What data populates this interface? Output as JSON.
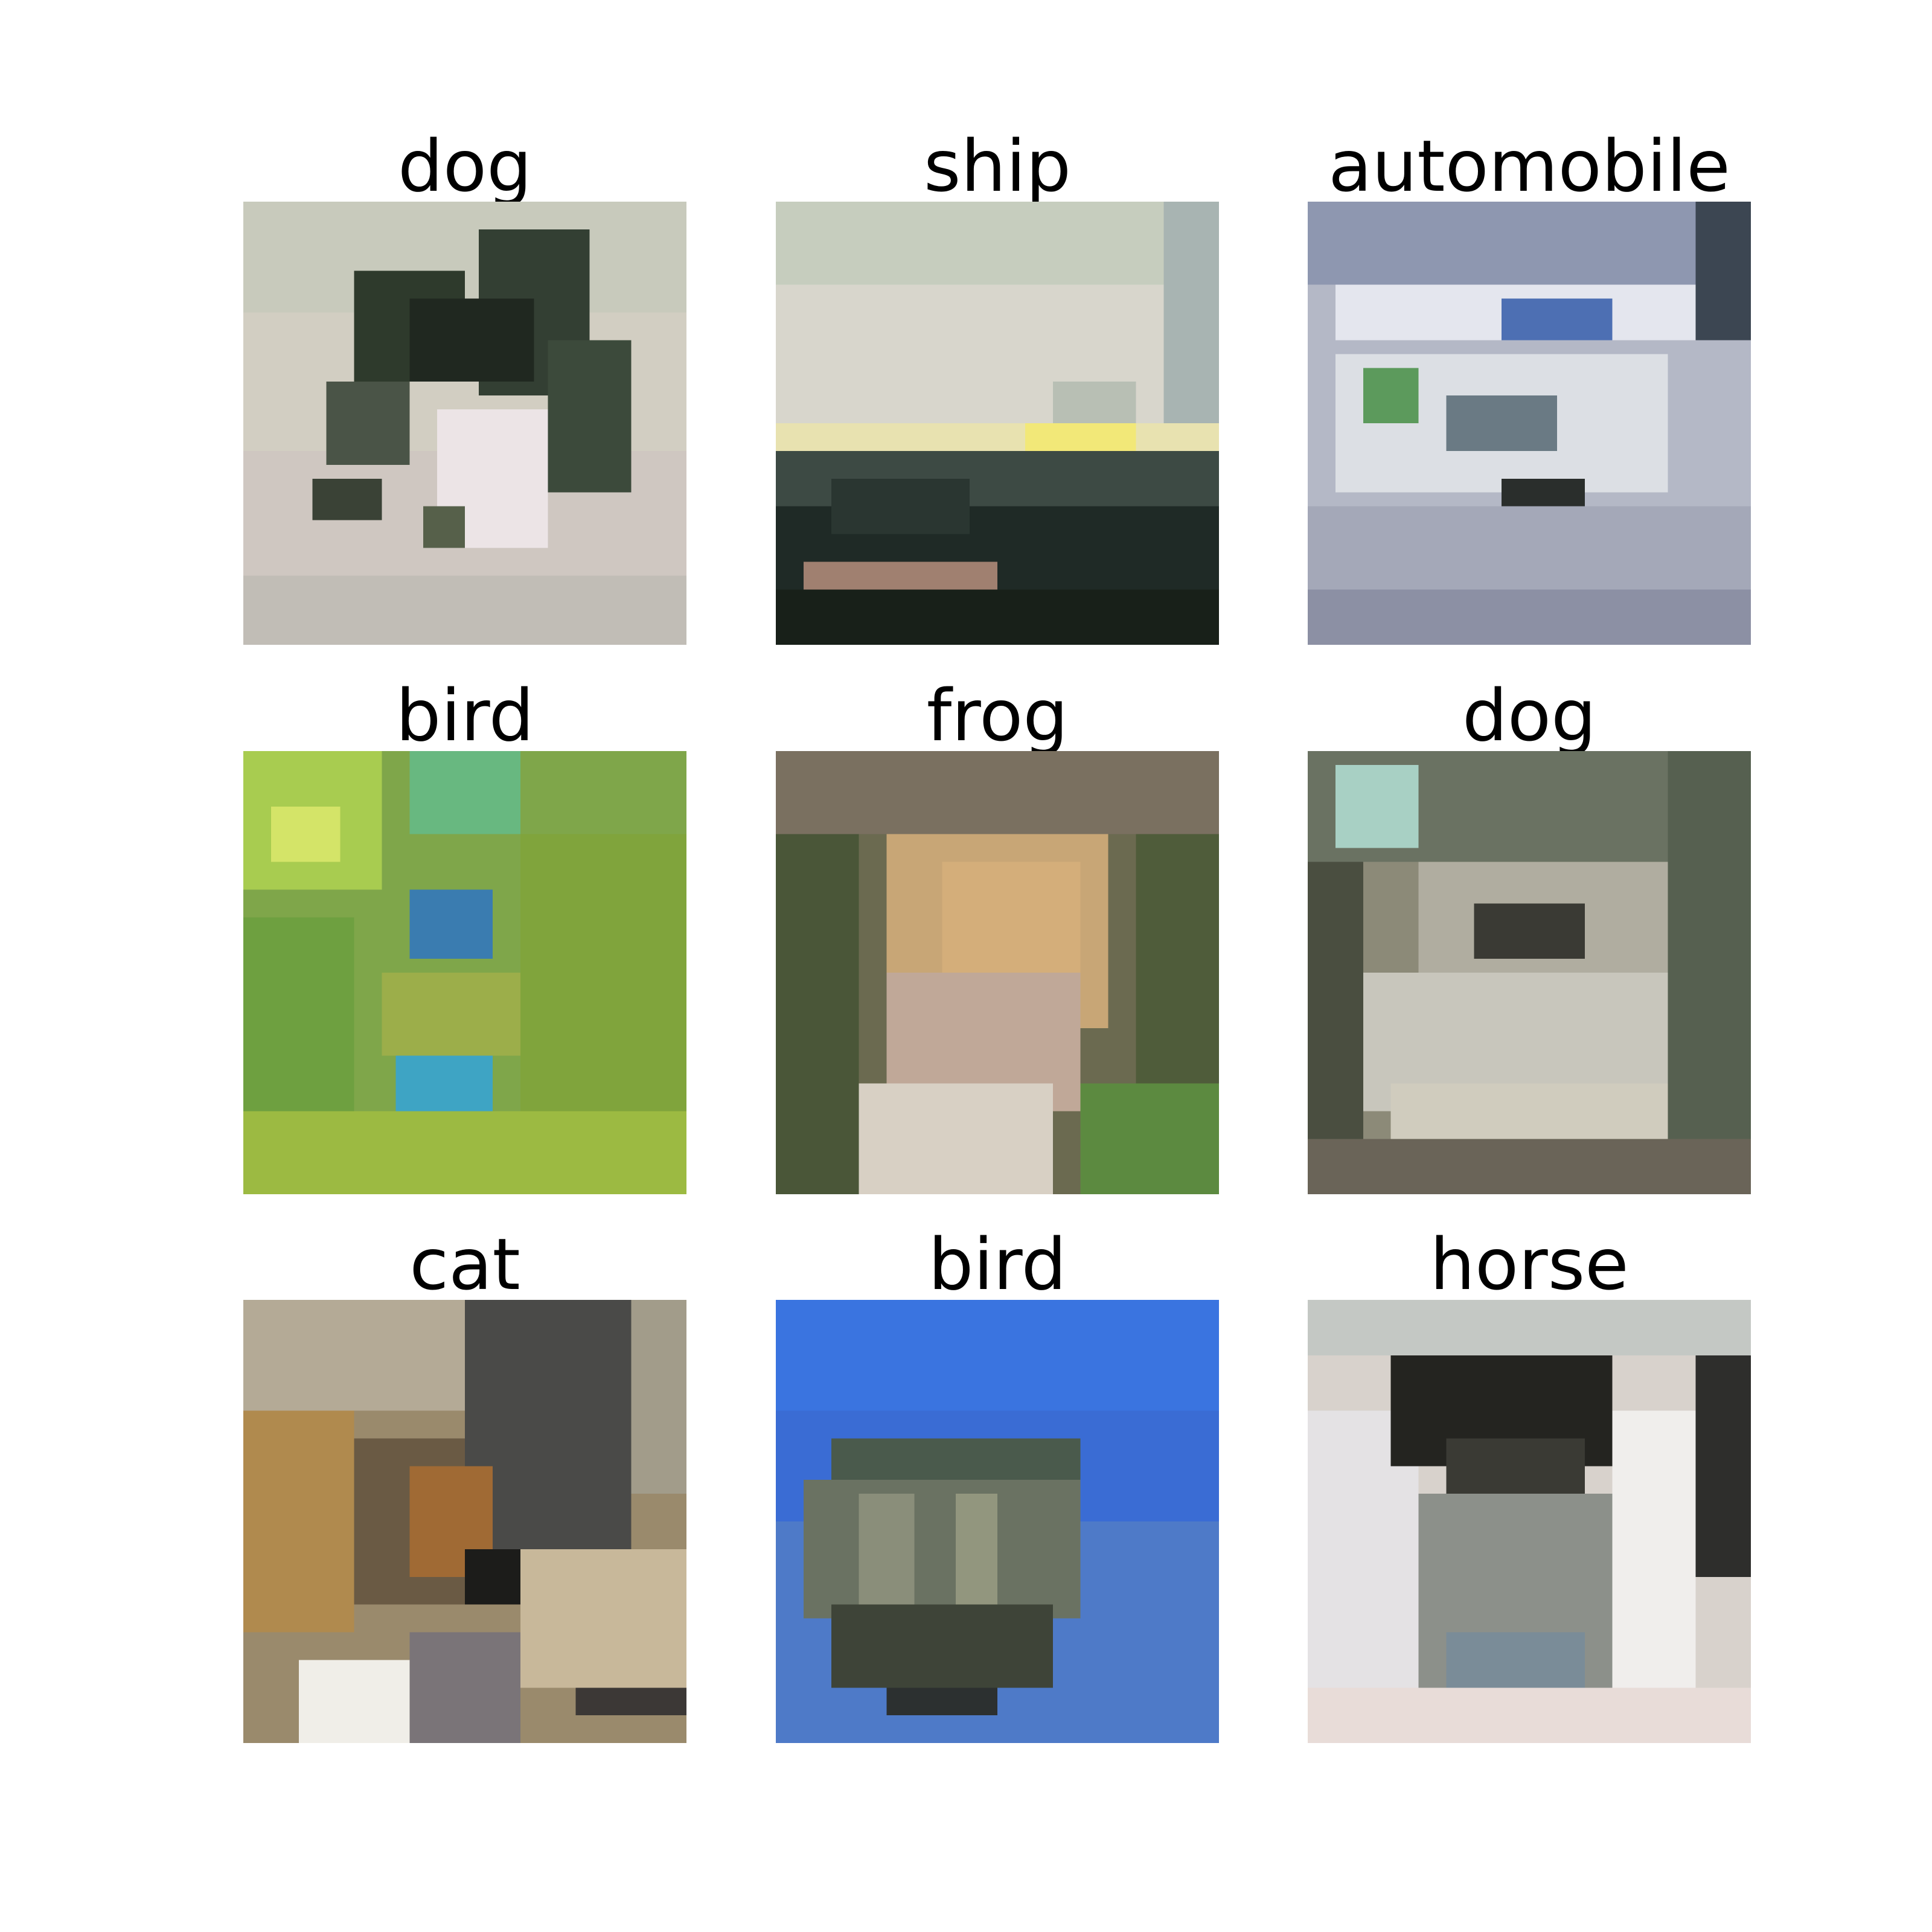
{
  "grid": {
    "samples": [
      {
        "label": "dog"
      },
      {
        "label": "ship"
      },
      {
        "label": "automobile"
      },
      {
        "label": "bird"
      },
      {
        "label": "frog"
      },
      {
        "label": "dog"
      },
      {
        "label": "cat"
      },
      {
        "label": "bird"
      },
      {
        "label": "horse"
      }
    ]
  }
}
